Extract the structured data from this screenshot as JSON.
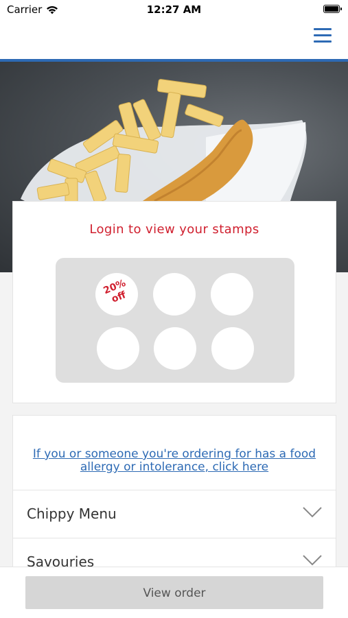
{
  "status_bar": {
    "carrier": "Carrier",
    "time": "12:27 AM",
    "wifi_icon": "wifi-icon",
    "battery_icon": "battery-icon"
  },
  "nav": {
    "menu_icon": "hamburger-menu-icon",
    "accent_color": "#2d6ab4"
  },
  "hero": {
    "image": "fish-and-chips-photo"
  },
  "stamps": {
    "title": "Login to view your stamps",
    "title_color": "#d0202f",
    "reward_line1": "20%",
    "reward_line2": "off",
    "total_stamps": 6
  },
  "menu": {
    "allergy_link": "If you or someone you're ordering for has a food allergy or intolerance, click here",
    "categories": [
      {
        "label": "Chippy Menu",
        "icon": "chevron-down-icon"
      },
      {
        "label": "Savouries",
        "icon": "chevron-down-icon"
      }
    ]
  },
  "footer": {
    "view_order_label": "View order"
  }
}
